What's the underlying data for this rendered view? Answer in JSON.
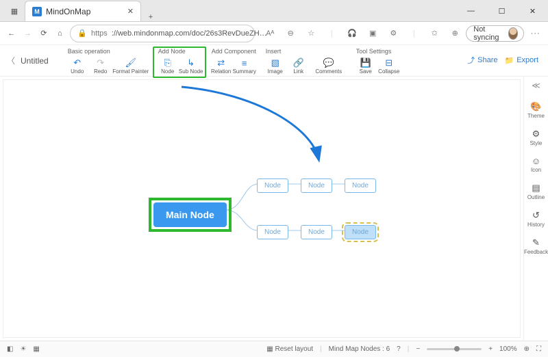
{
  "browser": {
    "tab_title": "MindOnMap",
    "favicon_letter": "M",
    "url_scheme": "https",
    "url_display": "://web.mindonmap.com/doc/26s3RevDueZH…",
    "sync_status": "Not syncing"
  },
  "toolbar": {
    "doc_title": "Untitled",
    "groups": {
      "basic": {
        "label": "Basic operation",
        "undo": "Undo",
        "redo": "Redo",
        "format_painter": "Format Painter"
      },
      "add_node": {
        "label": "Add Node",
        "node": "Node",
        "sub_node": "Sub Node"
      },
      "add_component": {
        "label": "Add Component",
        "relation": "Relation",
        "summary": "Summary"
      },
      "insert": {
        "label": "Insert",
        "image": "Image",
        "link": "Link",
        "comments": "Comments"
      },
      "tool_settings": {
        "label": "Tool Settings",
        "save": "Save",
        "collapse": "Collapse"
      }
    },
    "share": "Share",
    "export": "Export"
  },
  "rail": {
    "theme": "Theme",
    "style": "Style",
    "icon": "Icon",
    "outline": "Outline",
    "history": "History",
    "feedback": "Feedback"
  },
  "mindmap": {
    "main": "Main Node",
    "child": "Node"
  },
  "status": {
    "reset": "Reset layout",
    "count_label": "Mind Map Nodes :",
    "count_value": "6",
    "zoom_value": "100%"
  }
}
